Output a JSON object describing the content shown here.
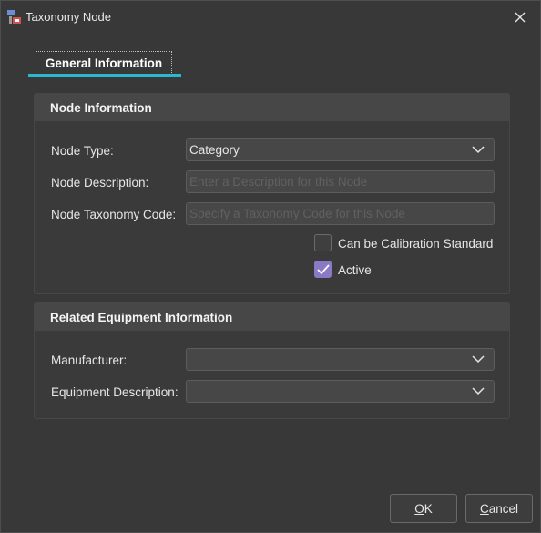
{
  "window": {
    "title": "Taxonomy Node"
  },
  "tabs": [
    {
      "label": "General Information",
      "active": true
    }
  ],
  "node_information": {
    "header": "Node Information",
    "node_type": {
      "label": "Node Type:",
      "value": "Category"
    },
    "node_description": {
      "label": "Node Description:",
      "value": "",
      "placeholder": "Enter a Description for this Node"
    },
    "node_taxonomy_code": {
      "label": "Node Taxonomy Code:",
      "value": "",
      "placeholder": "Specify a Taxonomy Code for this Node"
    },
    "calibration_standard": {
      "label": "Can be Calibration Standard",
      "checked": false
    },
    "active": {
      "label": "Active",
      "checked": true
    }
  },
  "related_equipment": {
    "header": "Related Equipment Information",
    "manufacturer": {
      "label": "Manufacturer:",
      "value": ""
    },
    "equipment_description": {
      "label": "Equipment Description:",
      "value": ""
    }
  },
  "buttons": {
    "ok": {
      "mnemonic": "O",
      "rest": "K"
    },
    "cancel": {
      "mnemonic": "C",
      "rest": "ancel"
    }
  },
  "colors": {
    "accent_underline": "#2bb7cf",
    "checkbox_checked": "#8a79c4",
    "background": "#383838"
  },
  "icons": {
    "app": "taxonomy-app-icon",
    "close": "close-icon",
    "dropdown": "chevron-down-icon",
    "check": "checkmark-icon"
  }
}
